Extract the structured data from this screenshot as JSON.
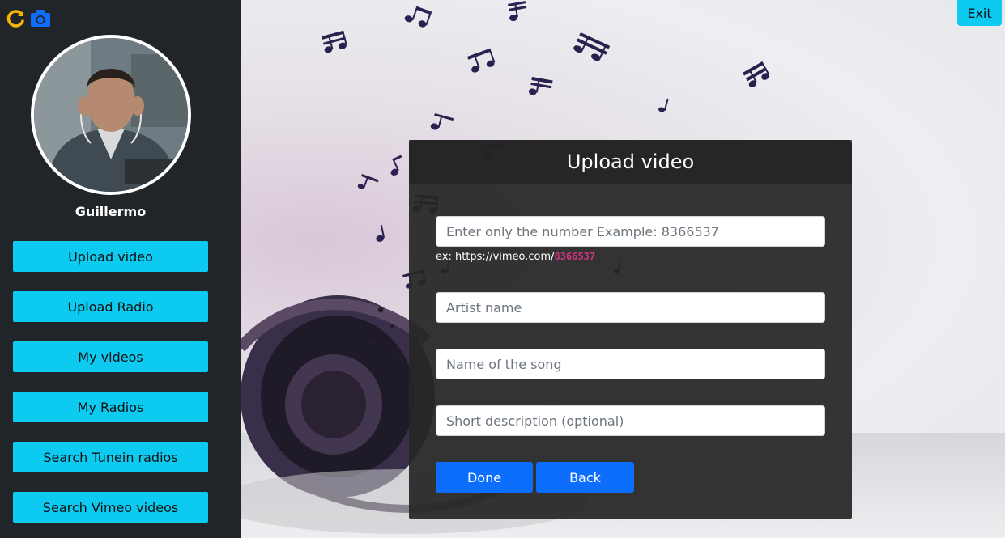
{
  "colors": {
    "sidebar_bg": "#212529",
    "sidebar_button": "#0dcaf0",
    "primary_button": "#0d6efd",
    "hint_code": "#d63384",
    "refresh_icon": "#f5b800",
    "camera_icon": "#0d6efd"
  },
  "sidebar": {
    "icons": [
      "refresh-icon",
      "camera-icon"
    ],
    "username": "Guillermo",
    "items": [
      {
        "label": "Upload video"
      },
      {
        "label": "Upload Radio"
      },
      {
        "label": "My videos"
      },
      {
        "label": "My Radios"
      },
      {
        "label": "Search Tunein radios"
      },
      {
        "label": "Search Vimeo videos"
      }
    ]
  },
  "header": {
    "exit_label": "Exit"
  },
  "modal": {
    "title": "Upload video",
    "video_id": {
      "value": "",
      "placeholder": "Enter only the number Example: 8366537"
    },
    "hint_prefix": "ex: https://vimeo.com/",
    "hint_code": "8366537",
    "artist": {
      "value": "",
      "placeholder": "Artist name"
    },
    "song": {
      "value": "",
      "placeholder": "Name of the song"
    },
    "description": {
      "value": "",
      "placeholder": "Short description (optional)"
    },
    "done_label": "Done",
    "back_label": "Back"
  }
}
